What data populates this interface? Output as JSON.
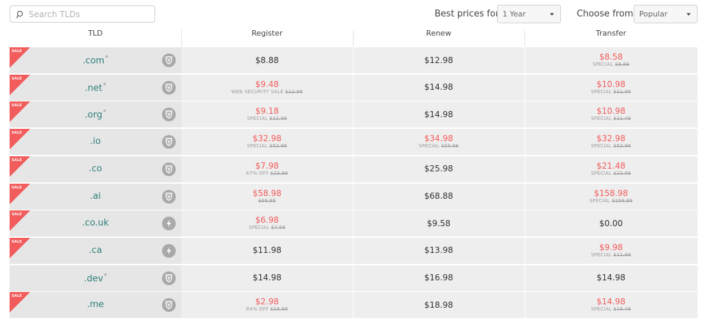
{
  "search": {
    "placeholder": "Search TLDs"
  },
  "controls": {
    "best_prices_label": "Best prices for",
    "best_prices_value": "1 Year",
    "choose_from_label": "Choose from",
    "choose_from_value": "Popular"
  },
  "columns": [
    "TLD",
    "Register",
    "Renew",
    "Transfer"
  ],
  "sale_badge": "SALE",
  "colors": {
    "sale_red": "#f25c5c",
    "tld_teal": "#2f7f7a",
    "row_bg": "#eeeeee"
  },
  "rows": [
    {
      "tld": ".com",
      "star": "*",
      "sale": true,
      "icon": "shield-icon",
      "register": {
        "price": "$8.88",
        "red": false,
        "note": "",
        "old": ""
      },
      "renew": {
        "price": "$12.98",
        "red": false,
        "note": "",
        "old": ""
      },
      "transfer": {
        "price": "$8.58",
        "red": true,
        "note": "SPECIAL",
        "old": "$8.88"
      }
    },
    {
      "tld": ".net",
      "star": "*",
      "sale": true,
      "icon": "shield-icon",
      "register": {
        "price": "$9.48",
        "red": true,
        "note": "WEB SECURITY SALE",
        "old": "$12.98"
      },
      "renew": {
        "price": "$14.98",
        "red": false,
        "note": "",
        "old": ""
      },
      "transfer": {
        "price": "$10.98",
        "red": true,
        "note": "SPECIAL",
        "old": "$11.88"
      }
    },
    {
      "tld": ".org",
      "star": "*",
      "sale": true,
      "icon": "shield-icon",
      "register": {
        "price": "$9.18",
        "red": true,
        "note": "SPECIAL",
        "old": "$12.98"
      },
      "renew": {
        "price": "$14.98",
        "red": false,
        "note": "",
        "old": ""
      },
      "transfer": {
        "price": "$10.98",
        "red": true,
        "note": "SPECIAL",
        "old": "$11.48"
      }
    },
    {
      "tld": ".io",
      "star": "",
      "sale": true,
      "icon": "shield-icon",
      "register": {
        "price": "$32.98",
        "red": true,
        "note": "SPECIAL",
        "old": "$53.98"
      },
      "renew": {
        "price": "$34.98",
        "red": true,
        "note": "SPECIAL",
        "old": "$55.98"
      },
      "transfer": {
        "price": "$32.98",
        "red": true,
        "note": "SPECIAL",
        "old": "$53.98"
      }
    },
    {
      "tld": ".co",
      "star": "",
      "sale": true,
      "icon": "shield-icon",
      "register": {
        "price": "$7.98",
        "red": true,
        "note": "67% OFF",
        "old": "$23.98"
      },
      "renew": {
        "price": "$25.98",
        "red": false,
        "note": "",
        "old": ""
      },
      "transfer": {
        "price": "$21.48",
        "red": true,
        "note": "SPECIAL",
        "old": "$22.99"
      }
    },
    {
      "tld": ".ai",
      "star": "",
      "sale": true,
      "icon": "shield-icon",
      "register": {
        "price": "$58.98",
        "red": true,
        "note": "",
        "old": "$68.88"
      },
      "renew": {
        "price": "$68.88",
        "red": false,
        "note": "",
        "old": ""
      },
      "transfer": {
        "price": "$158.98",
        "red": true,
        "note": "SPECIAL",
        "old": "$168.98"
      }
    },
    {
      "tld": ".co.uk",
      "star": "",
      "sale": true,
      "icon": "bolt-icon",
      "register": {
        "price": "$6.98",
        "red": true,
        "note": "SPECIAL",
        "old": "$7.58"
      },
      "renew": {
        "price": "$9.58",
        "red": false,
        "note": "",
        "old": ""
      },
      "transfer": {
        "price": "$0.00",
        "red": false,
        "note": "",
        "old": ""
      }
    },
    {
      "tld": ".ca",
      "star": "",
      "sale": true,
      "icon": "bolt-icon",
      "register": {
        "price": "$11.98",
        "red": false,
        "note": "",
        "old": ""
      },
      "renew": {
        "price": "$13.98",
        "red": false,
        "note": "",
        "old": ""
      },
      "transfer": {
        "price": "$9.98",
        "red": true,
        "note": "SPECIAL",
        "old": "$11.98"
      }
    },
    {
      "tld": ".dev",
      "star": "*",
      "sale": false,
      "icon": "shield-icon",
      "register": {
        "price": "$14.98",
        "red": false,
        "note": "",
        "old": ""
      },
      "renew": {
        "price": "$16.98",
        "red": false,
        "note": "",
        "old": ""
      },
      "transfer": {
        "price": "$14.98",
        "red": false,
        "note": "",
        "old": ""
      }
    },
    {
      "tld": ".me",
      "star": "",
      "sale": true,
      "icon": "shield-icon",
      "register": {
        "price": "$2.98",
        "red": true,
        "note": "84% OFF",
        "old": "$18.98"
      },
      "renew": {
        "price": "$18.98",
        "red": false,
        "note": "",
        "old": ""
      },
      "transfer": {
        "price": "$14.98",
        "red": true,
        "note": "SPECIAL",
        "old": "$18.48"
      }
    }
  ]
}
